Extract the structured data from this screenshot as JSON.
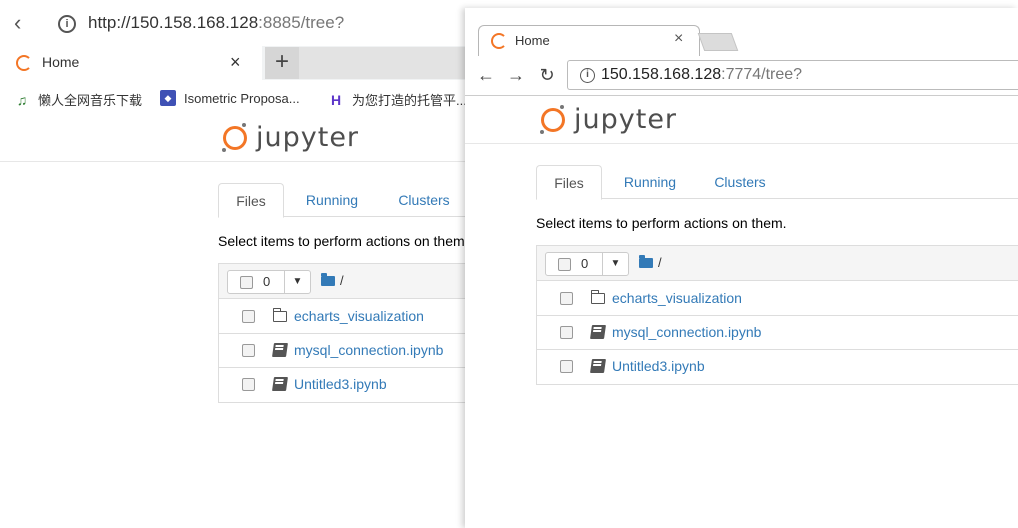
{
  "left_browser": {
    "address": {
      "url_main": "http://150.158.168.128",
      "url_rest": ":8885/tree?"
    },
    "tab": {
      "title": "Home",
      "close": "×"
    },
    "new_tab": "+",
    "bookmarks": [
      {
        "label": "懒人全网音乐下载",
        "icon": "music-note-icon"
      },
      {
        "label": "Isometric Proposa...",
        "icon": "isometric-icon"
      },
      {
        "label": "为您打造的托管平...",
        "icon": "h-logo-icon"
      }
    ],
    "jupyter": {
      "brand": "jupyter",
      "tabs": [
        "Files",
        "Running",
        "Clusters"
      ],
      "select_text": "Select items to perform actions on them.",
      "selected_count": "0",
      "breadcrumb": "/",
      "files": [
        {
          "name": "echarts_visualization",
          "type": "folder"
        },
        {
          "name": "mysql_connection.ipynb",
          "type": "notebook"
        },
        {
          "name": "Untitled3.ipynb",
          "type": "notebook"
        }
      ]
    }
  },
  "right_browser": {
    "tab": {
      "title": "Home",
      "close": "×"
    },
    "address": {
      "url_main": "150.158.168.128",
      "url_rest": ":7774/tree?"
    },
    "jupyter": {
      "brand": "jupyter",
      "tabs": [
        "Files",
        "Running",
        "Clusters"
      ],
      "select_text": "Select items to perform actions on them.",
      "selected_count": "0",
      "breadcrumb": "/",
      "files": [
        {
          "name": "echarts_visualization",
          "type": "folder"
        },
        {
          "name": "mysql_connection.ipynb",
          "type": "notebook"
        },
        {
          "name": "Untitled3.ipynb",
          "type": "notebook"
        }
      ]
    }
  },
  "colors": {
    "jupyter_orange": "#f37626",
    "link_blue": "#337ab7"
  }
}
